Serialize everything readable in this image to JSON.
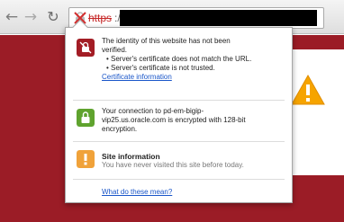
{
  "toolbar": {
    "back_icon": "arrow-left-icon",
    "forward_icon": "arrow-right-icon",
    "reload_icon": "reload-icon",
    "url_scheme": "https",
    "url_separator": "://",
    "url_host_redacted": true
  },
  "popup": {
    "identity": {
      "icon": "broken-lock-icon",
      "line1": "The identity of this website has not been",
      "line2": "verified.",
      "bullets": [
        "• Server's certificate does not match the URL.",
        "• Server's certificate is not trusted."
      ],
      "link": "Certificate information"
    },
    "connection": {
      "icon": "lock-icon",
      "lines": [
        "Your connection to pd-em-bigip-",
        "vip25.us.oracle.com is encrypted with 128-bit",
        "encryption."
      ]
    },
    "site_info": {
      "icon": "warning-icon",
      "title": "Site information",
      "text": "You have never visited this site before today."
    },
    "help_link": "What do these mean?"
  },
  "colors": {
    "page_background": "#9b1c26",
    "link": "#1a56c9",
    "error_icon": "#a31d25",
    "secure_icon": "#5fa32e",
    "info_icon": "#f0a23a"
  }
}
